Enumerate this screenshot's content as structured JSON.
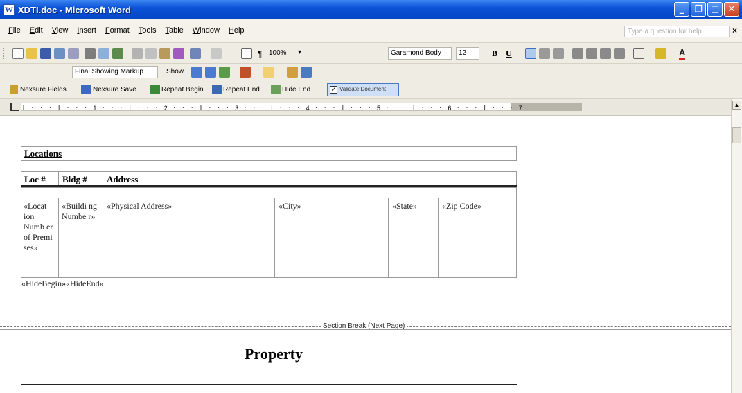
{
  "window": {
    "title": "XDTI.doc - Microsoft Word"
  },
  "menu": {
    "items": [
      "File",
      "Edit",
      "View",
      "Insert",
      "Format",
      "Tools",
      "Table",
      "Window",
      "Help"
    ],
    "help_placeholder": "Type a question for help",
    "close": "×"
  },
  "toolbar": {
    "zoom": "100%",
    "font": "Garamond Body",
    "size": "12",
    "bold": "B",
    "underline": "U",
    "markup": "Final Showing Markup",
    "show": "Show"
  },
  "nexsure": {
    "fields": "Nexsure Fields",
    "save": "Nexsure Save",
    "repeat_begin": "Repeat Begin",
    "repeat_end": "Repeat End",
    "hide_end": "Hide End",
    "validate": "Validate Document"
  },
  "doc": {
    "locations_title": "Locations",
    "headers": [
      "Loc #",
      "Bldg #",
      "Address"
    ],
    "row": {
      "loc": "«Locat ion Numb er of Premi ses»",
      "bldg": "«Buildi ng Numbe r»",
      "address": "«Physical Address»",
      "city": "«City»",
      "state": "«State»",
      "zip": "«Zip Code»"
    },
    "hide": "«HideBegin»«HideEnd»",
    "section_break": "Section Break (Next Page)",
    "property": "Property"
  }
}
